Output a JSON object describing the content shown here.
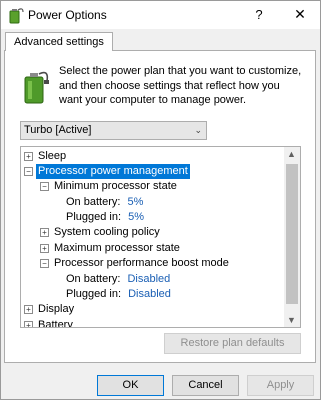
{
  "window": {
    "title": "Power Options",
    "help": "?",
    "close": "✕"
  },
  "tab": {
    "label": "Advanced settings"
  },
  "description": "Select the power plan that you want to customize, and then choose settings that reflect how you want your computer to manage power.",
  "plan_select": {
    "value": "Turbo [Active]"
  },
  "tree": {
    "sleep": "Sleep",
    "processor": "Processor power management",
    "min_state": "Minimum processor state",
    "on_battery_label": "On battery:",
    "plugged_in_label": "Plugged in:",
    "min_on_battery": "5%",
    "min_plugged_in": "5%",
    "cooling": "System cooling policy",
    "max_state": "Maximum processor state",
    "boost": "Processor performance boost mode",
    "boost_on_battery": "Disabled",
    "boost_plugged_in": "Disabled",
    "display": "Display",
    "battery": "Battery"
  },
  "buttons": {
    "restore": "Restore plan defaults",
    "ok": "OK",
    "cancel": "Cancel",
    "apply": "Apply"
  }
}
